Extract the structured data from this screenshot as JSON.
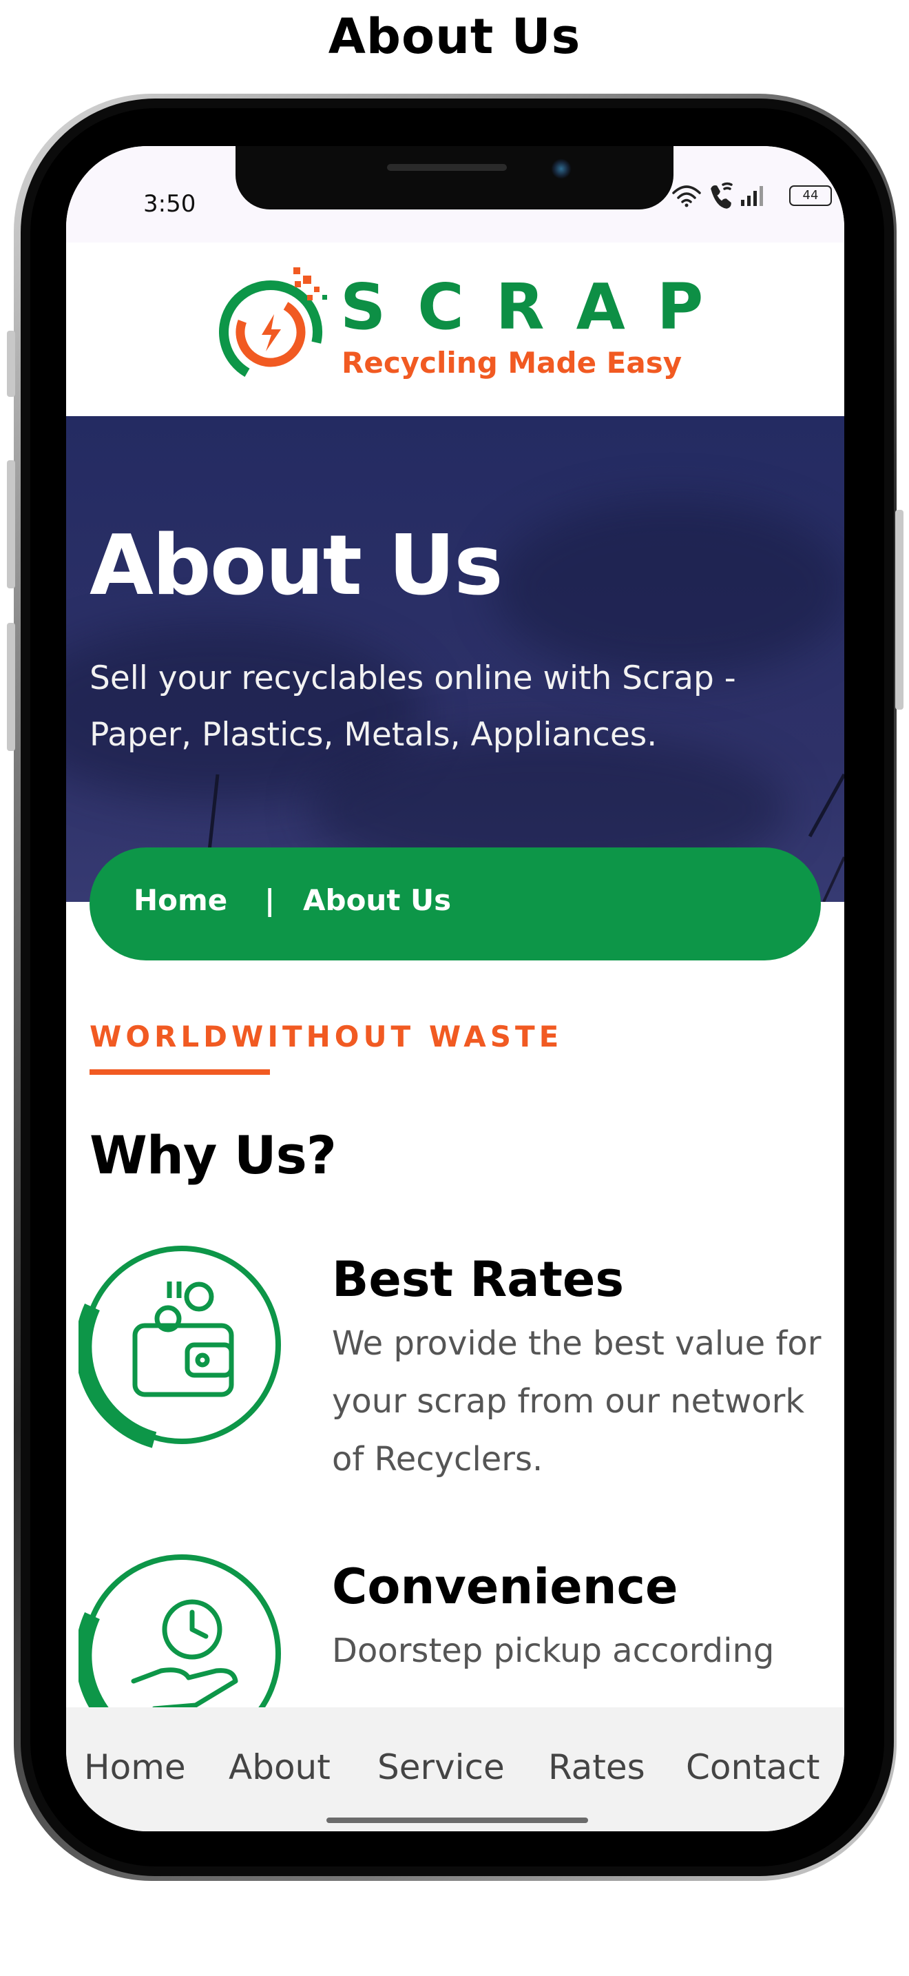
{
  "page": {
    "title": "About Us"
  },
  "status_bar": {
    "time": "3:50",
    "battery": "44",
    "icons": [
      "wifi-icon",
      "wifi-call-icon",
      "signal-icon",
      "battery-icon"
    ]
  },
  "brand": {
    "name": "SCRAP",
    "tagline": "Recycling Made Easy",
    "logo_icon": "bolt-ring-logo-icon"
  },
  "hero": {
    "title": "About Us",
    "subtitle": "Sell your recyclables online with Scrap - Paper, Plastics, Metals, Appliances."
  },
  "breadcrumb": {
    "home": "Home",
    "separator": "|",
    "current": "About Us"
  },
  "section": {
    "kicker": "WORLDWITHOUT WASTE",
    "heading": "Why Us?"
  },
  "features": [
    {
      "title": "Best Rates",
      "description": "We provide the best value for your scrap from our network of Recyclers.",
      "icon": "wallet-coins-icon"
    },
    {
      "title": "Convenience",
      "description": "Doorstep pickup according",
      "icon": "hand-clock-icon"
    }
  ],
  "bottom_nav": [
    "Home",
    "About",
    "Service",
    "Rates",
    "Contact"
  ],
  "colors": {
    "brand_green": "#0d9648",
    "brand_orange": "#f15a22",
    "hero_navy": "#2a2f66"
  }
}
